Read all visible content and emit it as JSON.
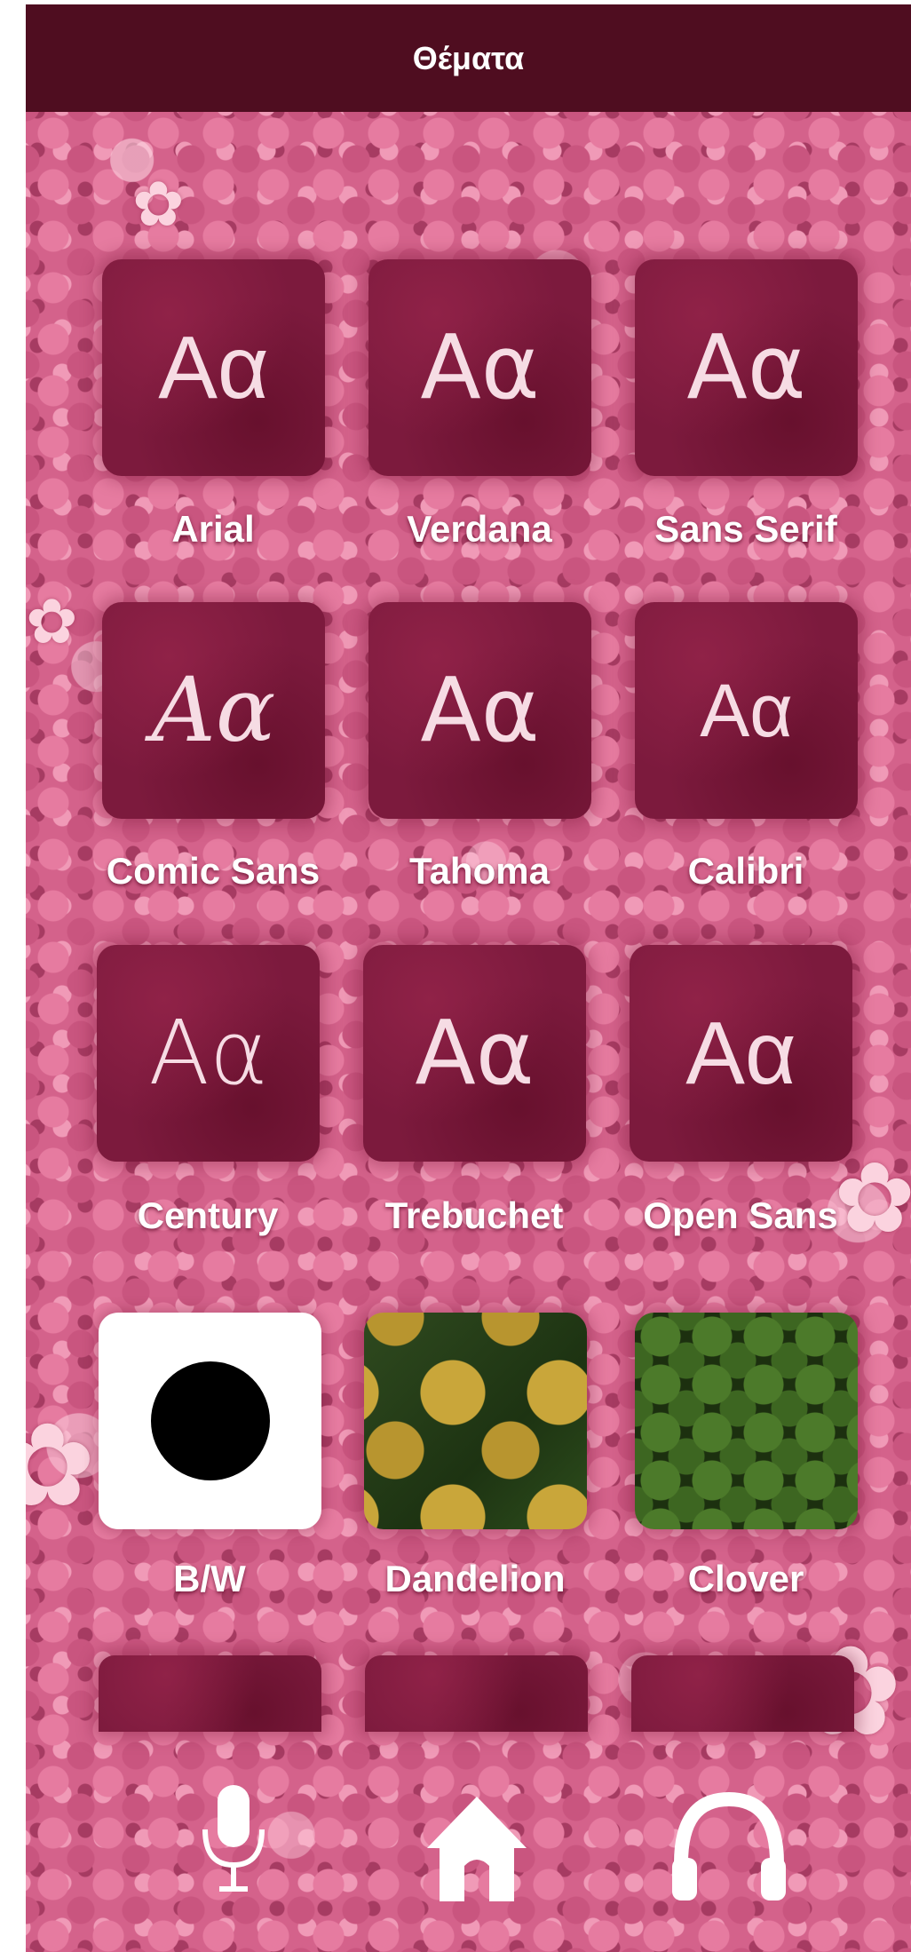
{
  "header": {
    "title": "Θέματα"
  },
  "fonts": [
    {
      "label": "Arial",
      "sample": "Aα"
    },
    {
      "label": "Verdana",
      "sample": "Aα"
    },
    {
      "label": "Sans Serif",
      "sample": "Aα"
    },
    {
      "label": "Comic Sans",
      "sample": "Aα"
    },
    {
      "label": "Tahoma",
      "sample": "Aα"
    },
    {
      "label": "Calibri",
      "sample": "Aα"
    },
    {
      "label": "Century",
      "sample": "Aα"
    },
    {
      "label": "Trebuchet",
      "sample": "Aα"
    },
    {
      "label": "Open Sans",
      "sample": "Aα"
    }
  ],
  "themes": [
    {
      "label": "B/W"
    },
    {
      "label": "Dandelion"
    },
    {
      "label": "Clover"
    }
  ],
  "bottom_nav": {
    "icons": [
      "microphone-icon",
      "home-icon",
      "headphones-icon"
    ]
  },
  "colors": {
    "header_bg": "#4f0d20",
    "tile_bg": "#7c1a3d",
    "background": "#d4628b",
    "text": "#ffffff"
  }
}
